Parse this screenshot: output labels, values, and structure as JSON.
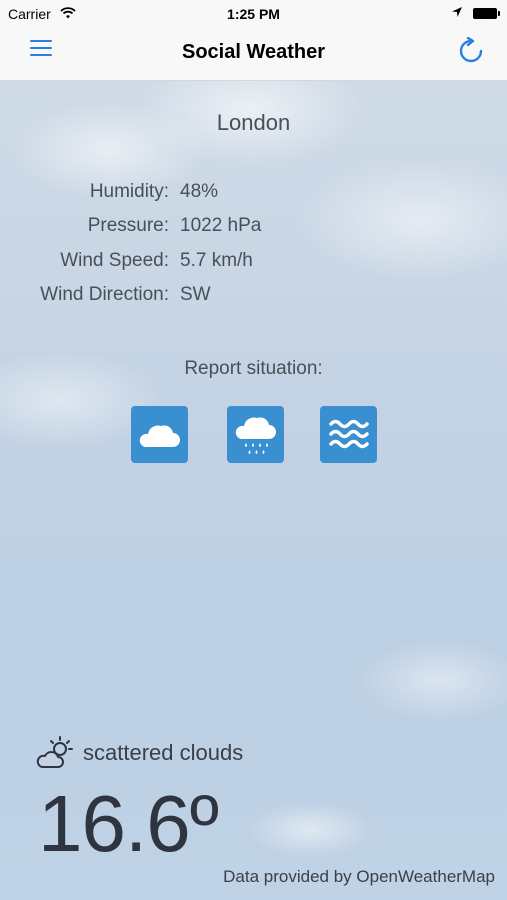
{
  "status_bar": {
    "carrier": "Carrier",
    "time": "1:25 PM"
  },
  "nav": {
    "title": "Social Weather",
    "menu_icon": "hamburger-menu-icon",
    "refresh_icon": "refresh-icon",
    "accent_color": "#2a7fe0"
  },
  "city": "London",
  "stats": [
    {
      "label": "Humidity:",
      "value": "48%"
    },
    {
      "label": "Pressure:",
      "value": "1022 hPa"
    },
    {
      "label": "Wind Speed:",
      "value": "5.7 km/h"
    },
    {
      "label": "Wind Direction:",
      "value": "SW"
    }
  ],
  "report": {
    "label": "Report situation:",
    "buttons": [
      {
        "icon": "cloud-icon"
      },
      {
        "icon": "rain-cloud-icon"
      },
      {
        "icon": "waves-icon"
      }
    ],
    "button_color": "#3a8fd0"
  },
  "condition": {
    "icon": "partly-cloudy-icon",
    "text": "scattered clouds"
  },
  "temperature": "16.6º",
  "credit": "Data provided by OpenWeatherMap"
}
